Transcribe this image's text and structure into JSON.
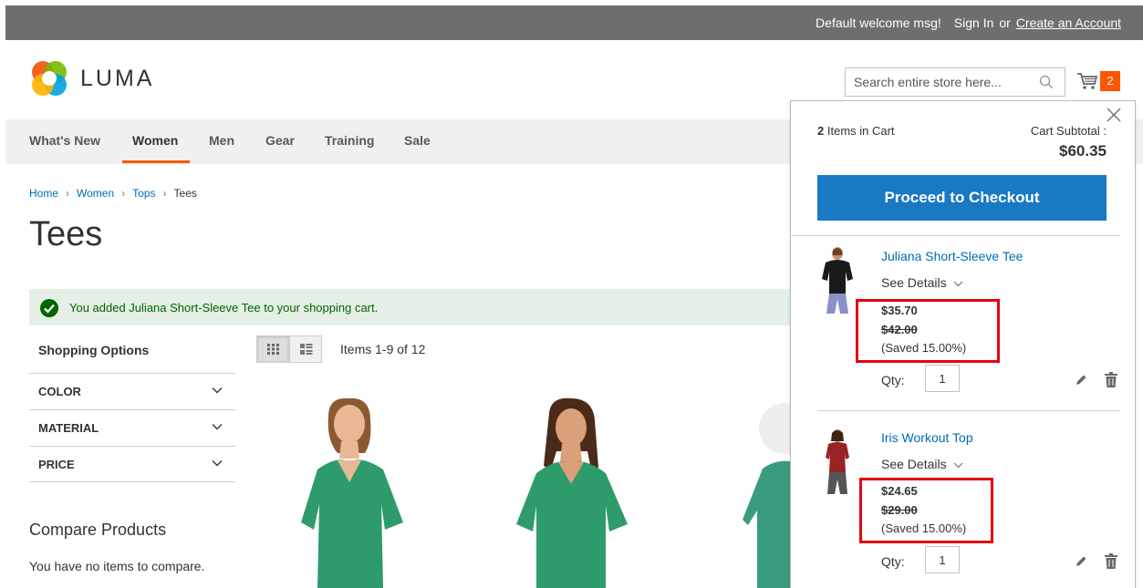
{
  "top_bar": {
    "welcome": "Default welcome msg!",
    "sign_in": "Sign In",
    "or": "or",
    "create_account": "Create an Account"
  },
  "header": {
    "logo_text": "LUMA",
    "search_placeholder": "Search entire store here...",
    "cart_count": "2"
  },
  "nav": {
    "items": [
      "What's New",
      "Women",
      "Men",
      "Gear",
      "Training",
      "Sale"
    ],
    "active": "Women"
  },
  "breadcrumb": [
    "Home",
    "Women",
    "Tops",
    "Tees"
  ],
  "page_title": "Tees",
  "message": "You added Juliana Short-Sleeve Tee to your shopping cart.",
  "sidebar": {
    "title": "Shopping Options",
    "filters": [
      "COLOR",
      "MATERIAL",
      "PRICE"
    ],
    "compare_title": "Compare Products",
    "compare_text": "You have no items to compare."
  },
  "toolbar": {
    "amount": "Items 1-9 of 12"
  },
  "minicart": {
    "items_count": "2",
    "items_label": "Items in Cart",
    "subtotal_label": "Cart Subtotal :",
    "subtotal": "$60.35",
    "checkout_label": "Proceed to Checkout",
    "items": [
      {
        "name": "Juliana Short-Sleeve Tee",
        "details_label": "See Details",
        "price": "$35.70",
        "old_price": "$42.00",
        "saved": "(Saved 15.00%)",
        "qty_label": "Qty:",
        "qty": "1"
      },
      {
        "name": "Iris Workout Top",
        "details_label": "See Details",
        "price": "$24.65",
        "old_price": "$29.00",
        "saved": "(Saved 15.00%)",
        "qty_label": "Qty:",
        "qty": "1"
      }
    ]
  },
  "colors": {
    "accent": "#ff5501",
    "link": "#006bb4",
    "button": "#1979c3",
    "highlight": "#e3040f",
    "product_green": "#2d9b6a",
    "product_red": "#9b2222"
  }
}
